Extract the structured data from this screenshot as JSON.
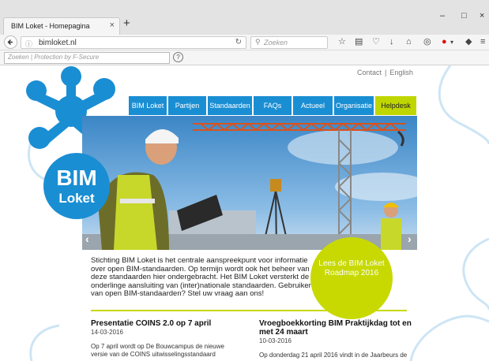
{
  "browser": {
    "tab_title": "BIM Loket - Homepagina",
    "tab_close": "×",
    "new_tab": "+",
    "window_minimize": "–",
    "window_maximize": "□",
    "window_close": "×",
    "url": "bimloket.nl",
    "search_placeholder": "Zoeken",
    "addon_placeholder": "Zoeken | Protection by F-Secure",
    "addon_help": "?"
  },
  "top_links": [
    "Contact",
    "English"
  ],
  "top_links_sep": "|",
  "nav": [
    "BIM Loket",
    "Partijen",
    "Standaarden",
    "FAQs",
    "Actueel",
    "Organisatie",
    "Helpdesk"
  ],
  "logo": {
    "line1": "BIM",
    "line2": "Loket"
  },
  "hero_arrows": {
    "prev": "‹",
    "next": "›"
  },
  "intro": "Stichting BIM Loket is het centrale aanspreekpunt voor informatie over open BIM-standaarden. Op termijn wordt ook het beheer van deze standaarden hier ondergebracht. Het BIM Loket versterkt de onderlinge aansluiting van (inter)nationale standaarden. Gebruiker van open BIM-standaarden? Stel uw vraag aan ons!",
  "roadmap": "Lees de BIM Loket Roadmap 2016",
  "news": [
    {
      "title": "Presentatie COINS 2.0 op 7 april",
      "date": "14-03-2016",
      "body": "Op 7 april wordt op De Bouwcampus de nieuwe versie van de COINS uitwisselingsstandaard"
    },
    {
      "title": "Vroegboekkorting BIM Praktijkdag tot en met 24 maart",
      "date": "10-03-2016",
      "body": "Op donderdag 21 april 2016 vindt in de Jaarbeurs de"
    }
  ],
  "colors": {
    "blue": "#1a8ed3",
    "lime": "#c7d900",
    "helpdesk": "#bfd600"
  }
}
